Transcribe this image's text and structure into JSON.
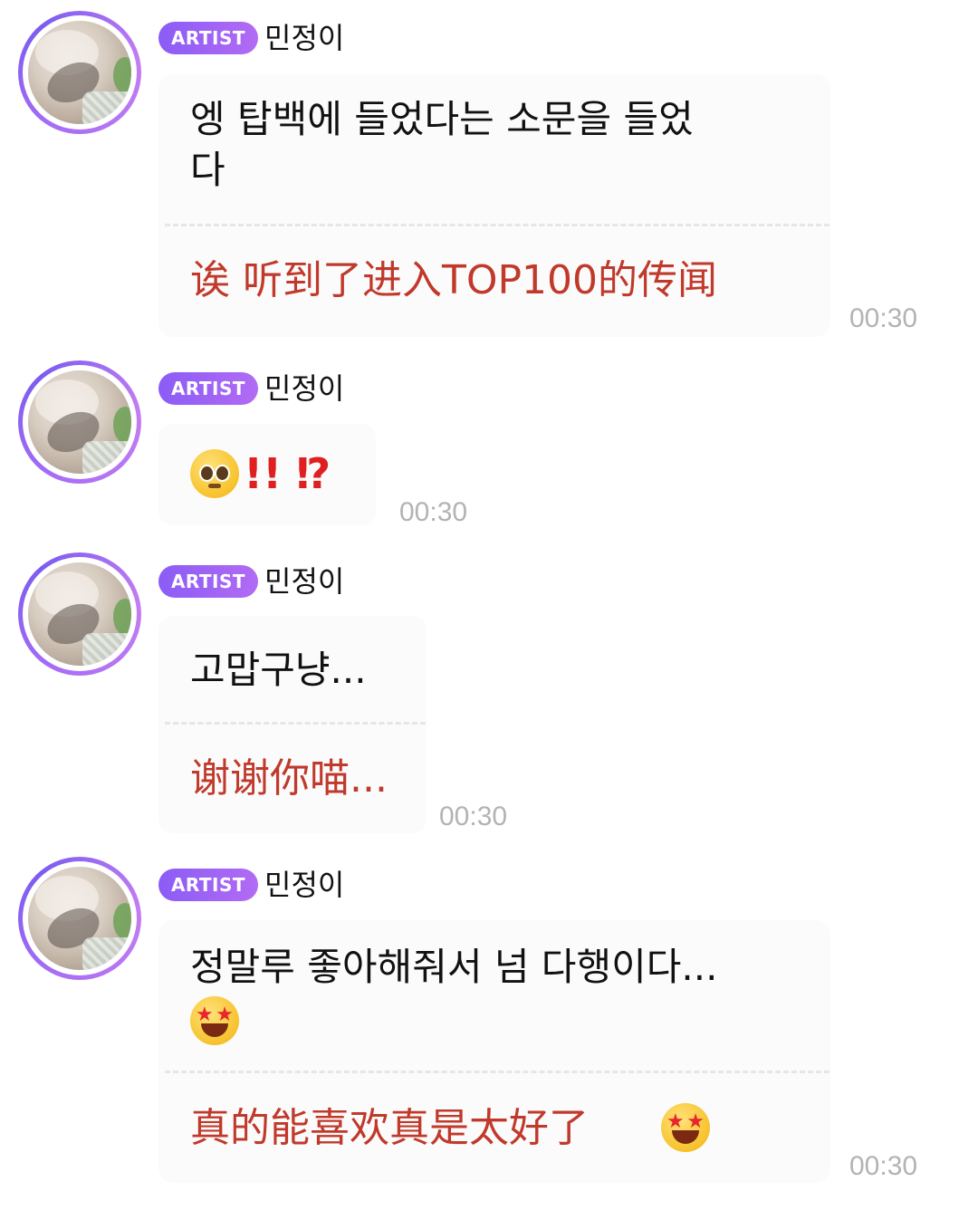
{
  "messages": [
    {
      "badge": "ARTIST",
      "name": "민정이",
      "korean_line1": "엥 탑백에 들었다는 소문을 들었",
      "korean_line2": "다",
      "chinese": "诶 听到了进入TOP100的传闻",
      "time": "00:30"
    },
    {
      "badge": "ARTIST",
      "name": "민정이",
      "korean_marks": "!! ⁉",
      "korean_emoji": "pleading-face-icon",
      "time": "00:30"
    },
    {
      "badge": "ARTIST",
      "name": "민정이",
      "korean_line1": "고맙구냥...",
      "chinese": "谢谢你喵...",
      "time": "00:30"
    },
    {
      "badge": "ARTIST",
      "name": "민정이",
      "korean_line1": "정말루 좋아해줘서 넘 다행이다...",
      "korean_emoji": "star-struck-icon",
      "chinese": "真的能喜欢真是太好了",
      "chinese_emoji": "star-struck-icon",
      "time": "00:30"
    }
  ],
  "colors": {
    "badge_gradient_start": "#8b5cf6",
    "badge_gradient_end": "#b26bf4",
    "translation_text": "#c0392b",
    "timestamp": "#b3b3b3",
    "avatar_ring": "#a96ef5"
  }
}
